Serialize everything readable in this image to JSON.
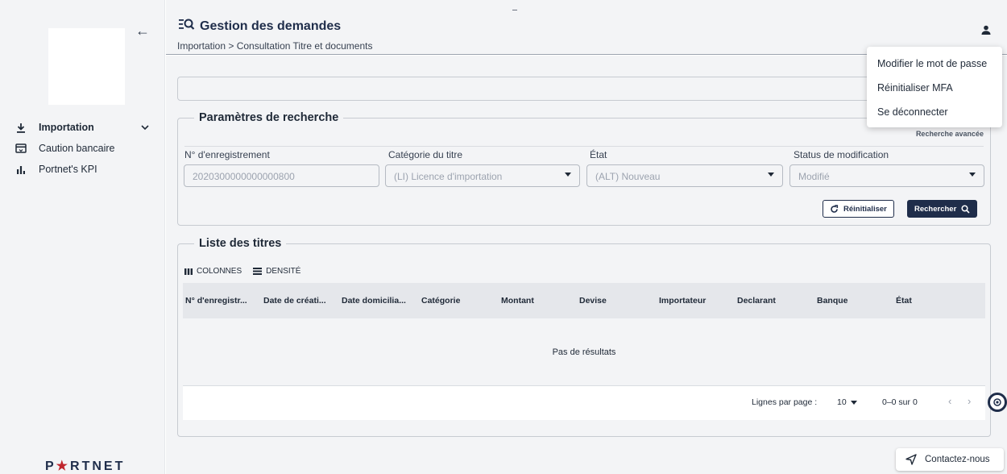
{
  "sidebar": {
    "items": [
      {
        "label": "Importation",
        "icon": "download-icon"
      },
      {
        "label": "Caution bancaire",
        "icon": "card-icon"
      },
      {
        "label": "Portnet's KPI",
        "icon": "bar-chart-icon"
      }
    ],
    "brand_left": "P",
    "brand_star": "★",
    "brand_right": "RTNET"
  },
  "header": {
    "title": "Gestion des demandes",
    "breadcrumb": "Importation > Consultation Titre et documents"
  },
  "user_menu": {
    "items": [
      "Modifier le mot de passe",
      "Réinitialiser MFA",
      "Se déconnecter"
    ]
  },
  "search": {
    "legend": "Paramètres de recherche",
    "advanced": "Recherche avancée",
    "fields": [
      {
        "label": "N° d'enregistrement",
        "value": "2020300000000000800"
      },
      {
        "label": "Catégorie du titre",
        "value": "(LI) Licence d'importation"
      },
      {
        "label": "État",
        "value": "(ALT) Nouveau"
      },
      {
        "label": "Status de modification",
        "value": "Modifié"
      }
    ],
    "reset": "Réinitialiser",
    "submit": "Rechercher"
  },
  "list": {
    "legend": "Liste des titres",
    "toolbar": {
      "columns": "COLONNES",
      "density": "DENSITÉ"
    },
    "columns": [
      "N° d'enregistr...",
      "Date de créati...",
      "Date domicilia...",
      "Catégorie",
      "Montant",
      "Devise",
      "Importateur",
      "Declarant",
      "Banque",
      "État"
    ],
    "empty": "Pas de résultats",
    "pagination": {
      "rows_label": "Lignes par page :",
      "rows_value": "10",
      "count": "0–0 sur 0"
    }
  },
  "contact": "Contactez-nous",
  "colors": {
    "primary": "#1f2d4a",
    "background": "#f3f4f6",
    "brand_red": "#c0262d"
  }
}
